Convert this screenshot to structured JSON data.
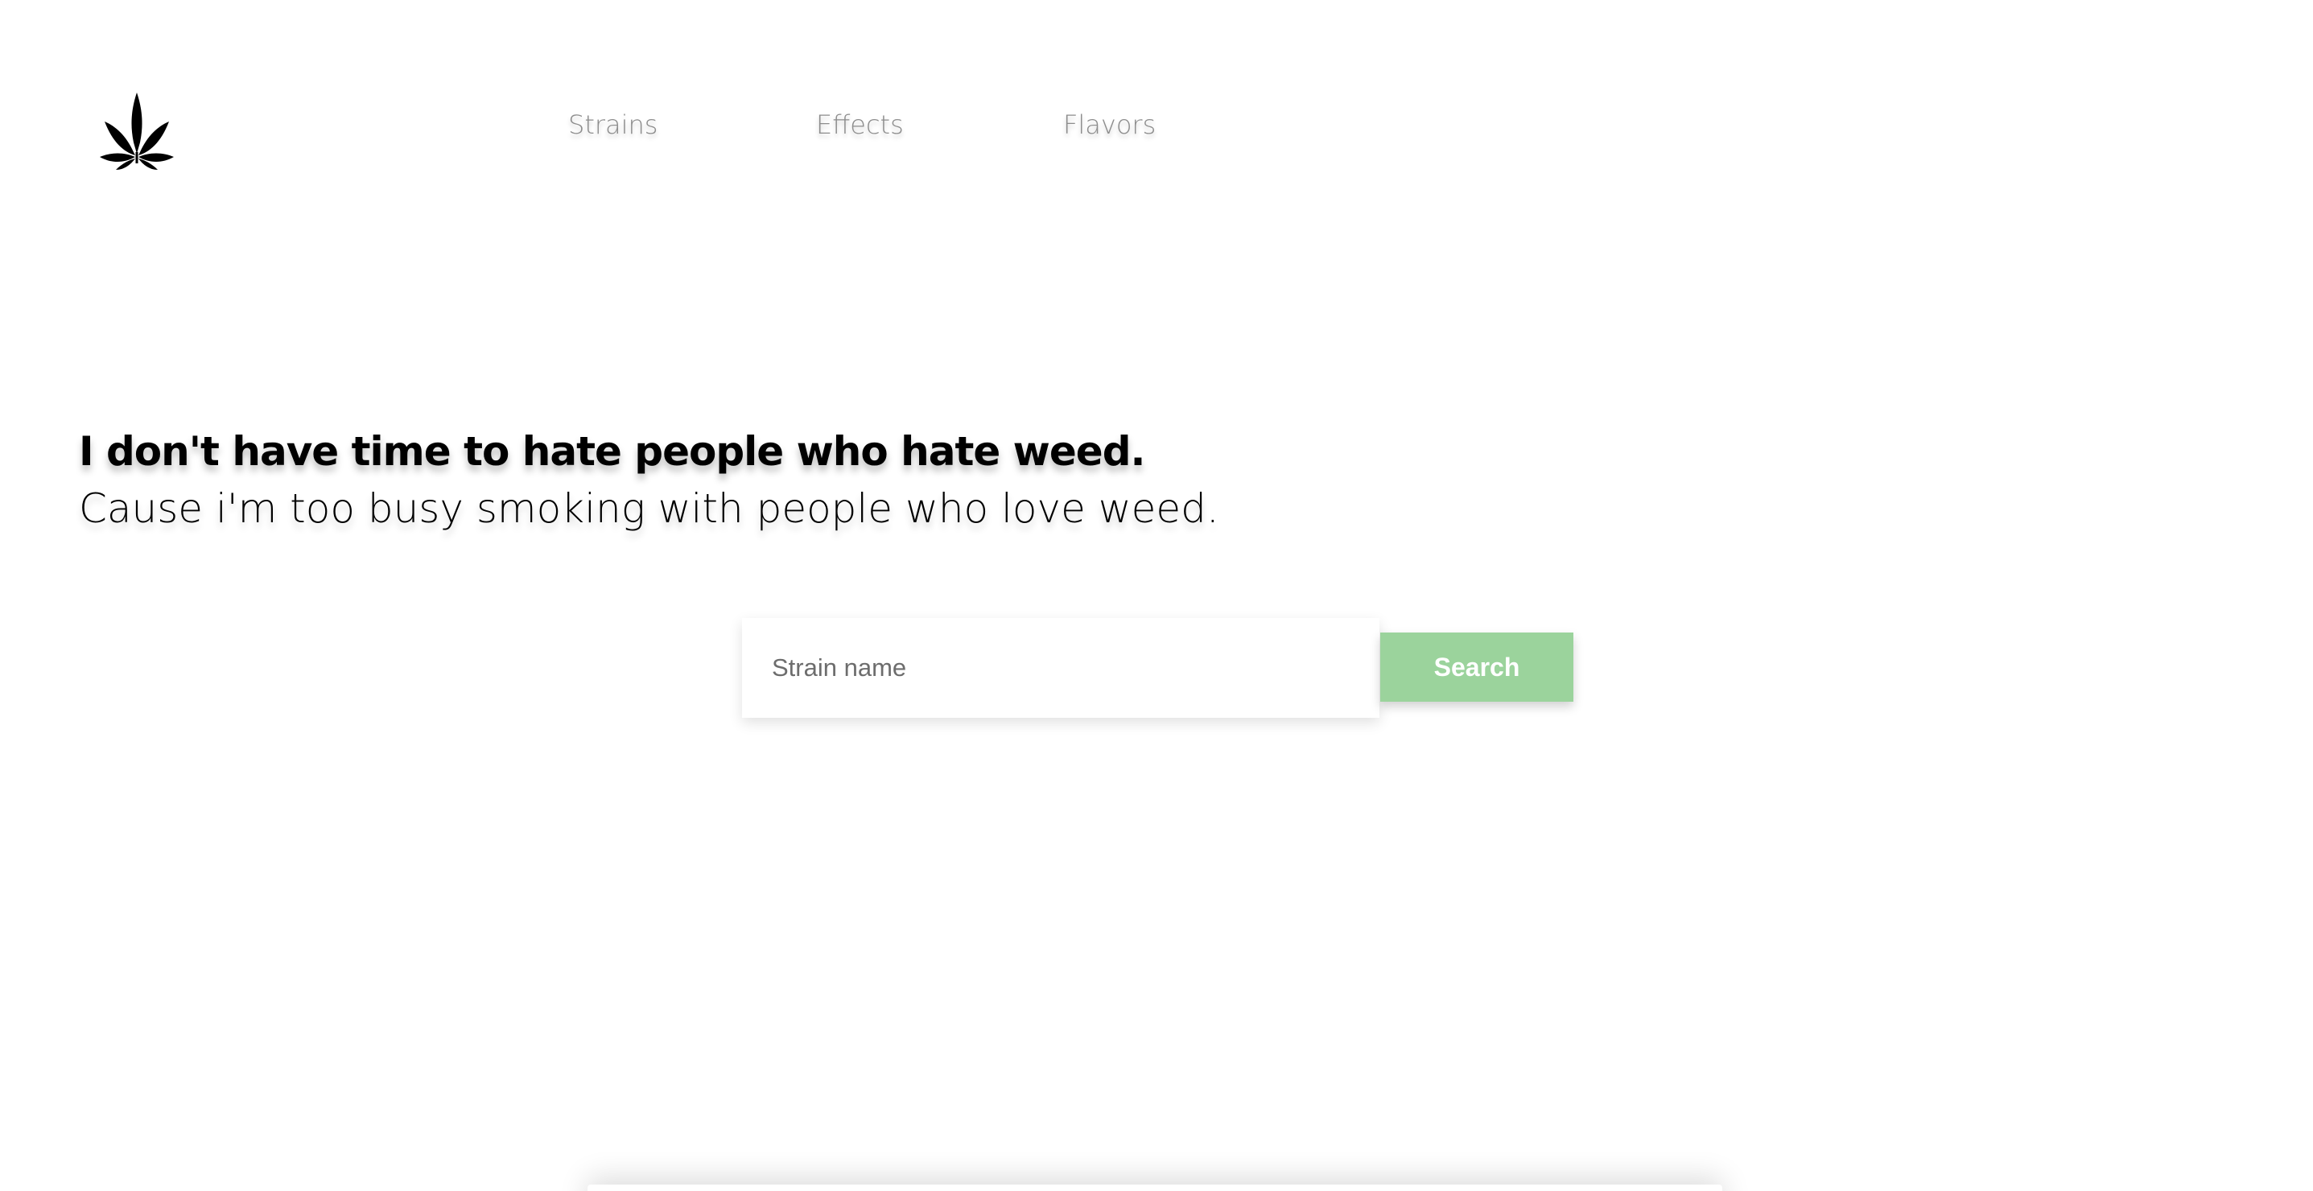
{
  "header": {
    "logo_icon": "cannabis-leaf-icon",
    "nav": [
      {
        "label": "Strains"
      },
      {
        "label": "Effects"
      },
      {
        "label": "Flavors"
      }
    ]
  },
  "hero": {
    "title": "I don't have time to hate people who hate weed.",
    "subtitle": "Cause i'm too busy smoking with people who love weed."
  },
  "search": {
    "placeholder": "Strain name",
    "value": "",
    "button_label": "Search"
  },
  "colors": {
    "accent": "#9bd39c",
    "nav_text": "#8c8c8c",
    "text": "#000000"
  }
}
